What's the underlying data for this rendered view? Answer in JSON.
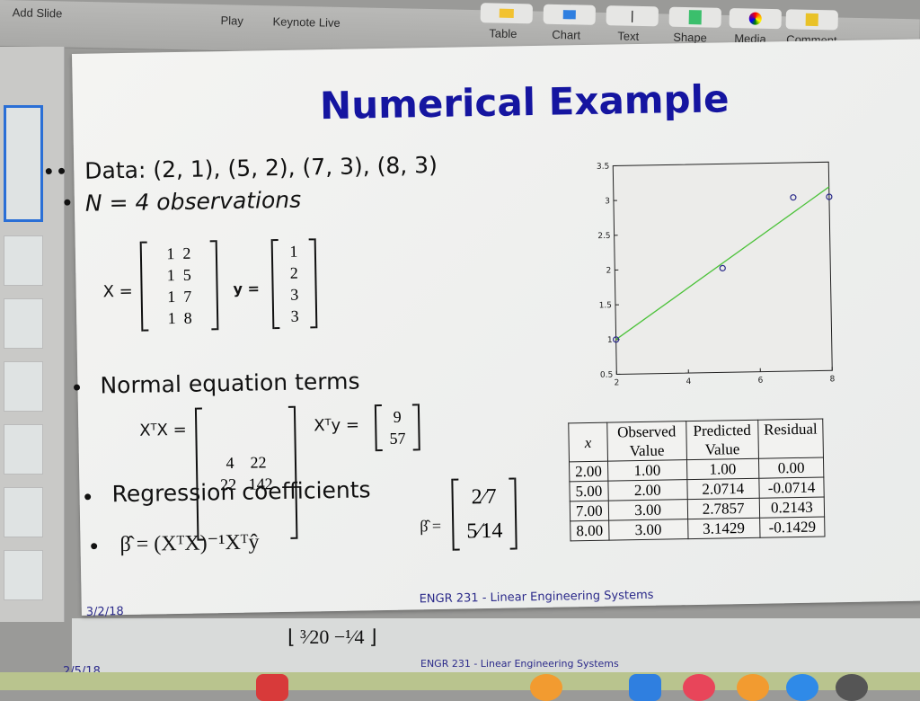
{
  "toolbar": {
    "add_slide": "Add Slide",
    "play": "Play",
    "keynote_live": "Keynote Live",
    "table": "Table",
    "chart": "Chart",
    "text": "Text",
    "shape": "Shape",
    "media": "Media",
    "comment": "Comment"
  },
  "slide": {
    "title": "Numerical Example",
    "bullet1": "Data: (2, 1), (5, 2), (7, 3), (8, 3)",
    "bullet2": "N = 4 observations",
    "X_label": "X =",
    "X_rows": [
      "1  2",
      "1  5",
      "1  7",
      "1  8"
    ],
    "y_label": "y =",
    "y_rows": [
      "1",
      "2",
      "3",
      "3"
    ],
    "bullet3": "Normal equation terms",
    "XtX_label": "XᵀX =",
    "XtX_rows": [
      "4    22",
      "22   142"
    ],
    "Xty_label": "Xᵀy =",
    "Xty_rows": [
      "9",
      "57"
    ],
    "bullet4": "Regression coefficients",
    "bullet5": "β̂ = (XᵀX)⁻¹Xᵀŷ",
    "beta_label": "β̂ =",
    "beta_rows": [
      "2⁄7",
      "5⁄14"
    ],
    "table": {
      "headers": [
        "x",
        "Observed Value",
        "Predicted Value",
        "Residual"
      ],
      "rows": [
        [
          "2.00",
          "1.00",
          "1.00",
          "0.00"
        ],
        [
          "5.00",
          "2.00",
          "2.0714",
          "-0.0714"
        ],
        [
          "7.00",
          "3.00",
          "2.7857",
          "0.2143"
        ],
        [
          "8.00",
          "3.00",
          "3.1429",
          "-0.1429"
        ]
      ]
    },
    "date": "3/2/18",
    "footer": "ENGR 231 - Linear Engineering Systems"
  },
  "lower_slide": {
    "fraction_text": "⌊ ³⁄20   −¹⁄4 ⌋",
    "date": "2/5/18",
    "footer": "ENGR 231 - Linear Engineering Systems"
  },
  "chart_data": {
    "type": "scatter",
    "xlim": [
      2,
      8
    ],
    "ylim": [
      0.5,
      3.5
    ],
    "xticks": [
      "2",
      "4",
      "6",
      "8"
    ],
    "yticks": [
      "0.5",
      "1",
      "1.5",
      "2",
      "2.5",
      "3",
      "3.5"
    ],
    "points": {
      "x": [
        2,
        5,
        7,
        8
      ],
      "y": [
        1,
        2,
        3,
        3
      ],
      "color": "#2a2a8a"
    },
    "fit_line": {
      "intercept": 0.2857,
      "slope": 0.3571,
      "color": "#4cc23a"
    },
    "grid": false
  }
}
